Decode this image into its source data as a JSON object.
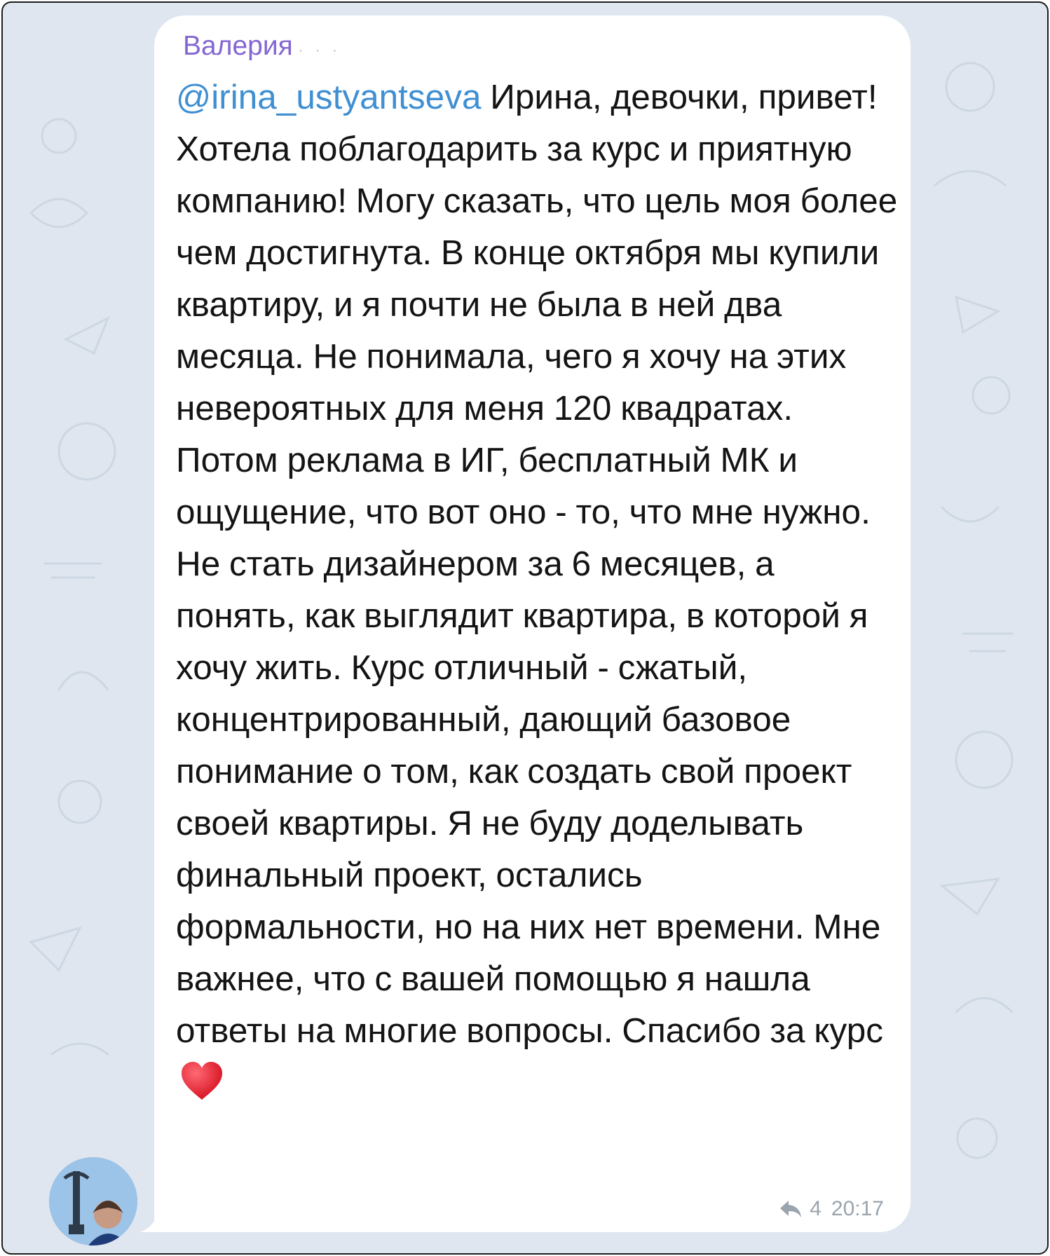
{
  "chat": {
    "sender_name": "Валерия",
    "message": {
      "mention": "@irina_ustyantseva",
      "text": " Ирина, девочки, привет! Хотела поблагодарить за курс и приятную компанию! Могу сказать, что цель моя более чем достигнута. В конце октября мы купили квартиру, и я почти не была в ней два месяца. Не понимала, чего я хочу на этих невероятных для меня 120 квадратах. Потом реклама в ИГ, бесплатный МК и ощущение, что вот оно - то, что мне нужно. Не стать дизайнером за 6 месяцев, а понять, как выглядит квартира, в которой я хочу жить. Курс отличный - сжатый, концентрированный, дающий базовое понимание о том, как создать свой проект своей квартиры. Я не буду доделывать финальный проект, остались формальности, но на них нет времени. Мне важнее, что с вашей помощью я нашла ответы на многие вопросы. Спасибо за курс",
      "emoji": "heart-emoji",
      "replies_count": "4",
      "time": "20:17"
    },
    "icons": {
      "reply": "reply-arrow-icon",
      "avatar": "user-avatar"
    },
    "colors": {
      "sender": "#8466d2",
      "mention": "#3f8fd3",
      "meta": "#9aa4ae",
      "background": "#dfe6ef",
      "heart": "#e8202f"
    }
  }
}
